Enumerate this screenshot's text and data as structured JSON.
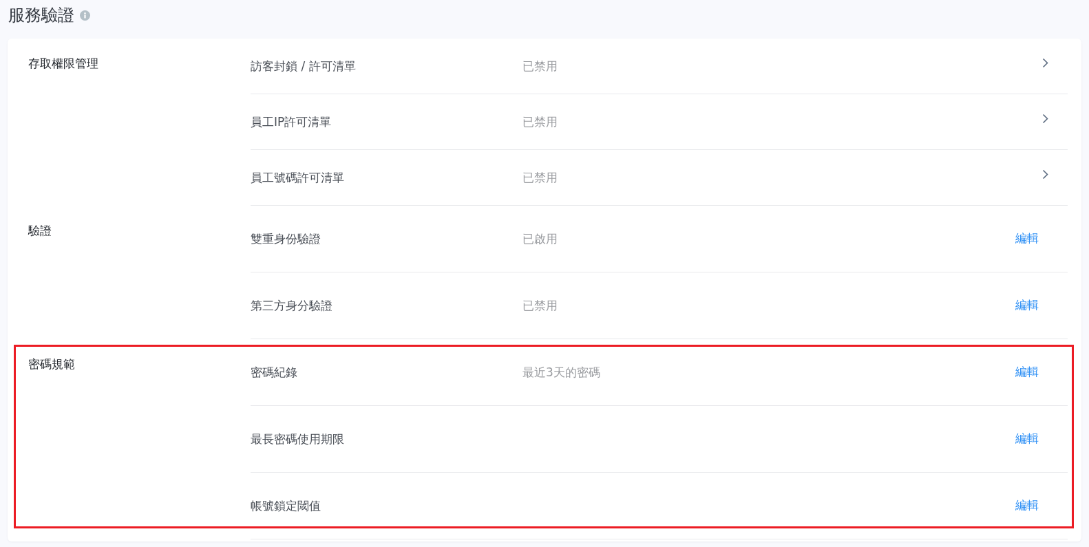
{
  "page": {
    "title": "服務驗證"
  },
  "sections": [
    {
      "label": "存取權限管理",
      "highlighted": false,
      "items": [
        {
          "kind": "nav",
          "name": "訪客封鎖 / 許可清單",
          "status": "已禁用"
        },
        {
          "kind": "nav",
          "name": "員工IP許可清單",
          "status": "已禁用"
        },
        {
          "kind": "nav",
          "name": "員工號碼許可清單",
          "status": "已禁用"
        }
      ]
    },
    {
      "label": "驗證",
      "highlighted": false,
      "items": [
        {
          "kind": "edit",
          "name": "雙重身份驗證",
          "status": "已啟用",
          "edit_label": "編輯"
        },
        {
          "kind": "edit",
          "name": "第三方身分驗證",
          "status": "已禁用",
          "edit_label": "編輯"
        }
      ]
    },
    {
      "label": "密碼規範",
      "highlighted": true,
      "items": [
        {
          "kind": "edit",
          "name": "密碼紀錄",
          "status": "最近3天的密碼",
          "edit_label": "編輯"
        },
        {
          "kind": "edit",
          "name": "最長密碼使用期限",
          "edit_label": "編輯"
        },
        {
          "kind": "edit",
          "name": "帳號鎖定閾值",
          "edit_label": "編輯"
        }
      ]
    }
  ]
}
